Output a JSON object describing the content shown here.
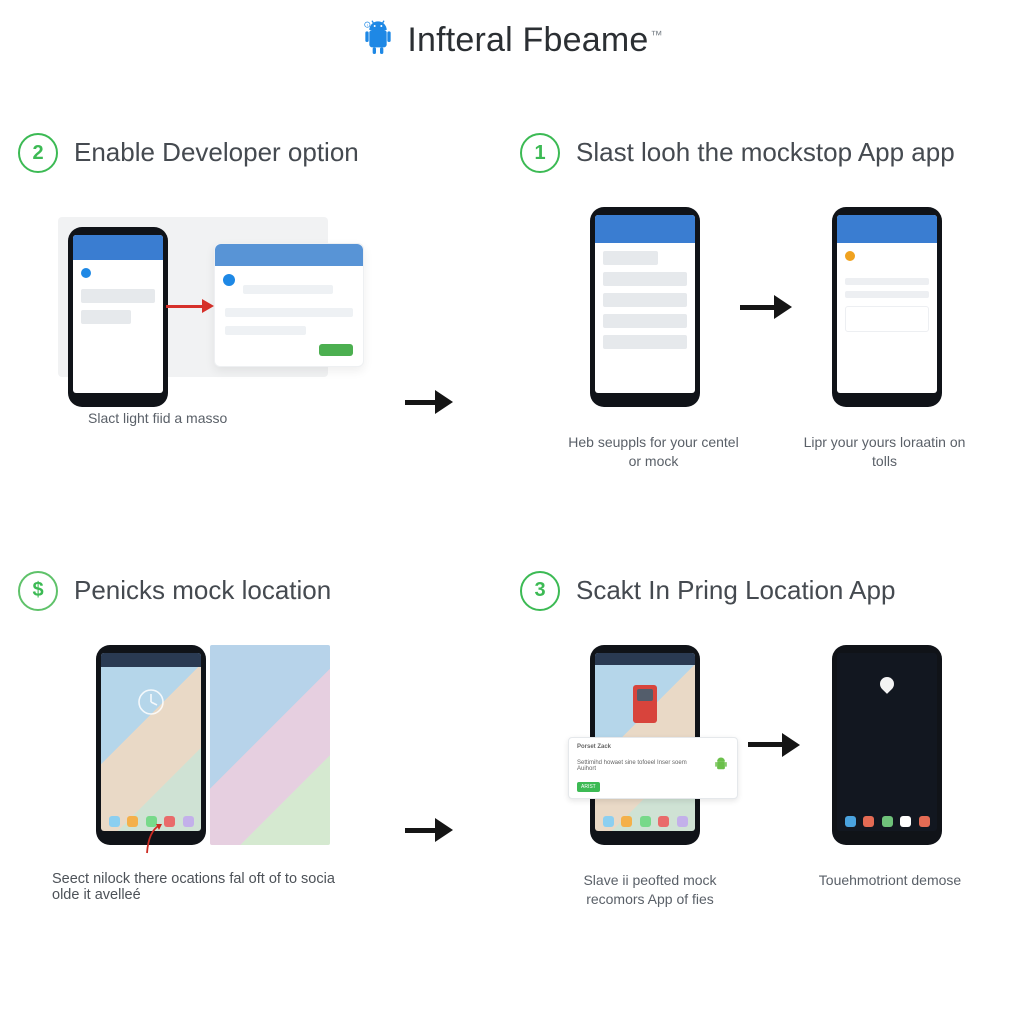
{
  "header": {
    "title": "Infteral Fbeame",
    "trademark": "™"
  },
  "steps": {
    "top_left": {
      "badge": "2",
      "title": "Enable Developer option",
      "caption": "Slact light fiid a masso"
    },
    "top_right": {
      "badge": "1",
      "title": "Slast looh the mockstop App app",
      "caption_left": "Heb seuppls for your centel or mock",
      "caption_right": "Lipr your yours loraatin on tolls"
    },
    "bottom_left": {
      "badge": "$",
      "title": "Penicks mock location",
      "caption": "Seect nilock there ocations fal oft of to socia olde it avelleé"
    },
    "bottom_right": {
      "badge": "3",
      "title": "Scakt In Pring Location App",
      "caption_left": "Slave ii peofted mock recomors App of fies",
      "caption_right": "Touehmotriont demose",
      "toast_heading": "Porset Zack",
      "toast_body": "Settimihd howaet sine tofoeel Inser soem  Auihort",
      "toast_button": "ARIST"
    }
  },
  "icons": {
    "android": "android-robot"
  }
}
